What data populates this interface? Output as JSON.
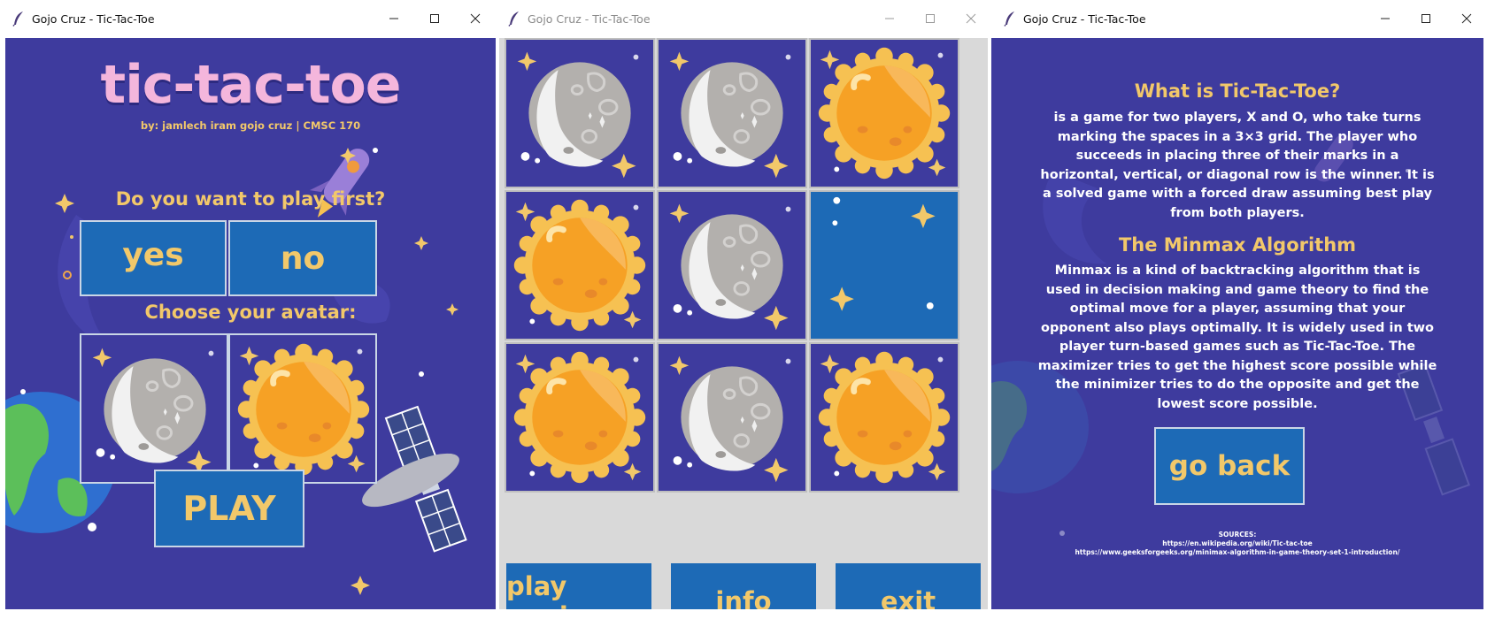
{
  "windows": {
    "left": {
      "title": "Gojo Cruz - Tic-Tac-Toe"
    },
    "middle": {
      "title": "Gojo Cruz - Tic-Tac-Toe"
    },
    "right": {
      "title": "Gojo Cruz - Tic-Tac-Toe"
    }
  },
  "menu": {
    "title": "tic-tac-toe",
    "byline": "by: jamlech iram gojo cruz | CMSC 170",
    "first_question": "Do you want to play first?",
    "yes_label": "yes",
    "no_label": "no",
    "avatar_question": "Choose your avatar:",
    "avatars": [
      "moon",
      "sun"
    ],
    "play_label": "PLAY"
  },
  "game": {
    "board": [
      "moon",
      "moon",
      "sun",
      "sun",
      "moon",
      "empty",
      "sun",
      "moon",
      "sun"
    ],
    "play_again_label": "play again",
    "info_label": "info",
    "exit_label": "exit"
  },
  "info": {
    "heading1": "What is Tic-Tac-Toe?",
    "para1_lines": [
      "is a game for two players, X and O, who take turns",
      "marking the spaces in a 3×3 grid. The player who",
      "succeeds in placing three of their marks in a",
      "horizontal, vertical, or  diagonal row is the winner. It is",
      "a solved game with a forced draw assuming best play",
      "from both players."
    ],
    "heading2": "The Minmax Algorithm",
    "para2_lines": [
      "Minmax is a kind of backtracking algorithm that is",
      "used in decision making and game theory to find the",
      "optimal move for a player, assuming that your",
      "opponent also plays  optimally. It is widely used in two",
      "player turn-based games such as Tic-Tac-Toe. The",
      "maximizer tries to get the highest score possible while",
      "the minimizer tries to do the opposite and get the",
      "lowest score possible."
    ],
    "go_back_label": "go back",
    "sources_label": "SOURCES:",
    "sources": [
      "https://en.wikipedia.org/wiki/Tic-tac-toe",
      "https://www.geeksforgeeks.org/minimax-algorithm-in-game-theory-set-1-introduction/"
    ]
  },
  "icons": {
    "app": "feather-icon",
    "minimize": "minimize-icon",
    "maximize": "maximize-icon",
    "close": "close-icon"
  },
  "colors": {
    "background": "#3e3b9e",
    "button": "#1d6ab6",
    "accent_text": "#f2c86a",
    "title_pink": "#f4b6dc",
    "moon": "#b8b5b2",
    "sun": "#f5a623"
  }
}
